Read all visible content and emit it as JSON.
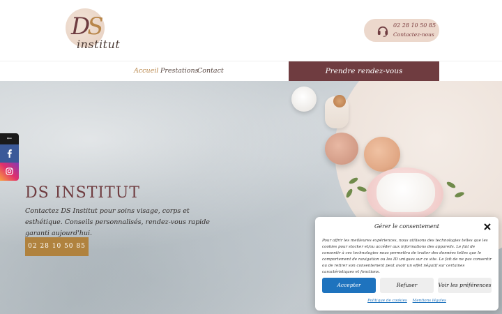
{
  "header": {
    "logo": {
      "monogram_d": "D",
      "monogram_s": "S",
      "wordmark": "institut"
    },
    "contact": {
      "phone": "02 28 10 50 85",
      "label": "Contactez-nous",
      "icon": "headset-icon"
    }
  },
  "nav": {
    "items": [
      {
        "label": "Accueil",
        "active": true
      },
      {
        "label": "Prestations",
        "active": false
      },
      {
        "label": "Contact",
        "active": false
      }
    ],
    "cta_label": "Prendre rendez-vous"
  },
  "hero": {
    "title": "DS INSTITUT",
    "description": "Contactez DS Institut pour soins visage, corps et esthétique. Conseils personnalisés, rendez-vous rapide garanti aujourd'hui.",
    "phone_button": "02 28 10 50 85"
  },
  "social": {
    "toggle": "←",
    "networks": [
      "facebook-icon",
      "instagram-icon"
    ]
  },
  "cookie_banner": {
    "title": "Gérer le consentement",
    "text": "Pour offrir les meilleures expériences, nous utilisons des technologies telles que les cookies pour stocker et/ou accéder aux informations des appareils. Le fait de consentir à ces technologies nous permettra de traiter des données telles que le comportement de navigation ou les ID uniques sur ce site. Le fait de ne pas consentir ou de retirer son consentement peut avoir un effet négatif sur certaines caractéristiques et fonctions.",
    "accept": "Accepter",
    "refuse": "Refuser",
    "preferences": "Voir les préférences",
    "links": [
      "Politique de cookies",
      "Mentions légales"
    ]
  },
  "colors": {
    "brand": "#6f3c40",
    "gold": "#b0823e",
    "accept_blue": "#1e73be"
  }
}
